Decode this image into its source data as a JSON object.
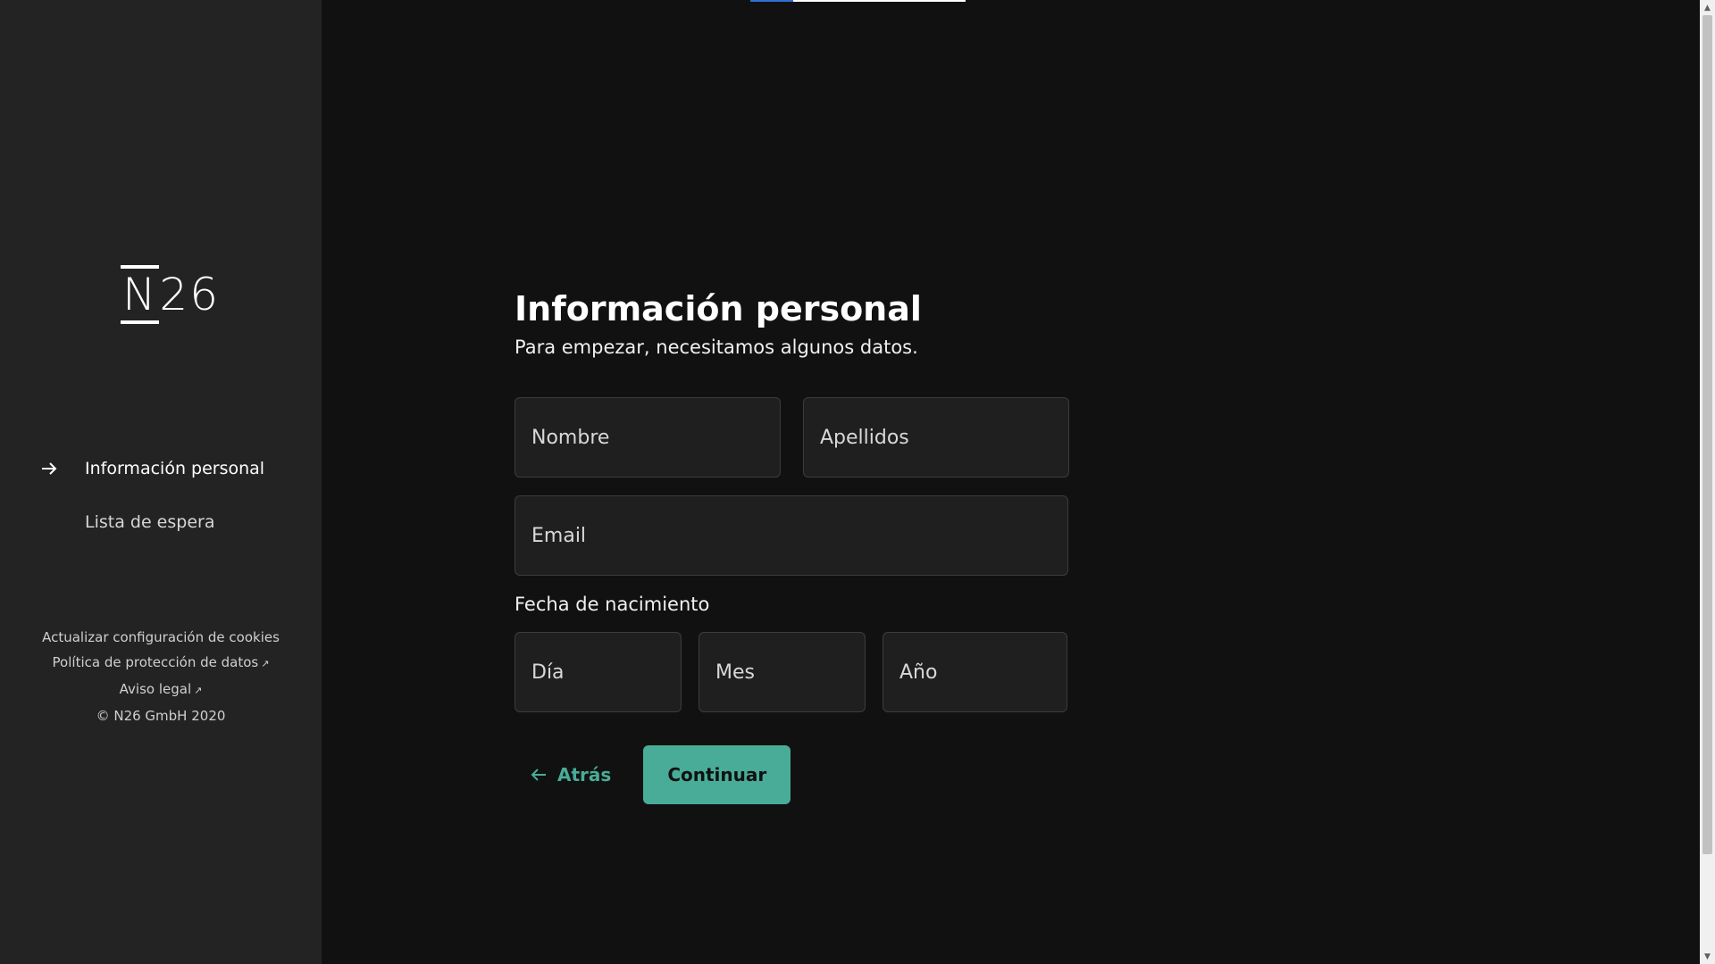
{
  "logo": {
    "n": "N",
    "rest": "26"
  },
  "sidebar": {
    "items": [
      {
        "label": "Información personal",
        "active": true
      },
      {
        "label": "Lista de espera",
        "active": false
      }
    ],
    "footer": {
      "cookies": "Actualizar configuración de cookies",
      "privacy": "Política de protección de datos",
      "legal": "Aviso legal",
      "ext_icon": "↗",
      "copyright": "© N26 GmbH 2020"
    }
  },
  "progress": {
    "fraction": 0.2
  },
  "form": {
    "title": "Información personal",
    "subtitle": "Para empezar, necesitamos algunos datos.",
    "first_name_placeholder": "Nombre",
    "last_name_placeholder": "Apellidos",
    "email_placeholder": "Email",
    "dob_label": "Fecha de nacimiento",
    "day_placeholder": "Día",
    "month_placeholder": "Mes",
    "year_placeholder": "Año",
    "back_label": "Atrás",
    "continue_label": "Continuar"
  },
  "colors": {
    "accent": "#48ac98",
    "sidebar_bg": "#232323",
    "main_bg": "#111111",
    "progress_fill": "#2e6fd6"
  },
  "icons": {
    "nav_active": "arrow-right-icon",
    "back": "arrow-left-icon",
    "external": "external-link-icon"
  }
}
